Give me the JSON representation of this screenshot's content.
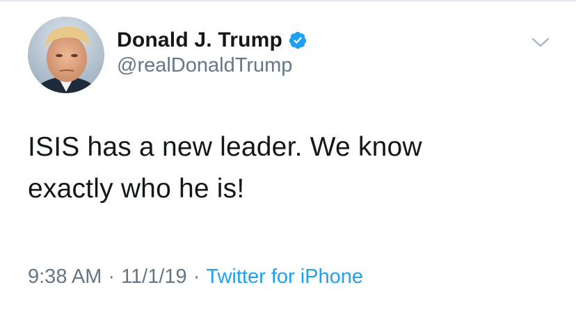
{
  "tweet": {
    "author": {
      "display_name": "Donald J. Trump",
      "handle": "@realDonaldTrump",
      "verified": true
    },
    "text_line1": "ISIS has a new leader. We know",
    "text_line2": "exactly who he is!",
    "time": "9:38 AM",
    "date": "11/1/19",
    "source": "Twitter for iPhone",
    "separator": "·"
  },
  "icons": {
    "verified": "verified-badge-icon",
    "more": "chevron-down-icon"
  },
  "colors": {
    "text_primary": "#14171a",
    "text_secondary": "#657786",
    "link": "#1da1f2",
    "verified_badge": "#1da1f2"
  }
}
